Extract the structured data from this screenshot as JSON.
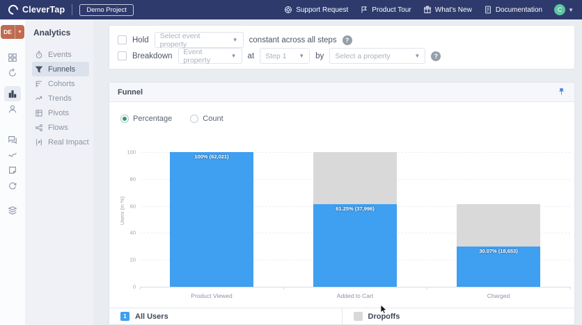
{
  "navbar": {
    "brand": "CleverTap",
    "project_button": "Demo Project",
    "links": [
      {
        "icon": "lifebuoy-icon",
        "label": "Support Request"
      },
      {
        "icon": "product-tour-icon",
        "label": "Product Tour"
      },
      {
        "icon": "gift-icon",
        "label": "What's New"
      },
      {
        "icon": "document-icon",
        "label": "Documentation"
      }
    ],
    "avatar_initial": "C"
  },
  "sidebar": {
    "account_badge": "DE",
    "menu_title": "Analytics",
    "items": [
      {
        "label": "Events",
        "active": false
      },
      {
        "label": "Funnels",
        "active": true
      },
      {
        "label": "Cohorts",
        "active": false
      },
      {
        "label": "Trends",
        "active": false
      },
      {
        "label": "Pivots",
        "active": false
      },
      {
        "label": "Flows",
        "active": false
      },
      {
        "label": "Real Impact",
        "active": false
      }
    ]
  },
  "filters": {
    "hold": {
      "label": "Hold",
      "dropdown_placeholder": "Select event property",
      "suffix": "constant across all steps"
    },
    "breakdown": {
      "label": "Breakdown",
      "dropdown1_placeholder": "Event property",
      "at_label": "at",
      "dropdown2_value": "Step 1",
      "by_label": "by",
      "dropdown3_placeholder": "Select a property"
    }
  },
  "funnel_panel": {
    "title": "Funnel",
    "view_options": [
      {
        "label": "Percentage",
        "selected": true
      },
      {
        "label": "Count",
        "selected": false
      }
    ]
  },
  "chart_data": {
    "type": "bar",
    "stacked": true,
    "title": "Funnel",
    "ylabel": "Users (in %)",
    "ylim": [
      0,
      100
    ],
    "yticks": [
      0,
      20,
      40,
      60,
      80,
      100
    ],
    "categories": [
      "Product Viewed",
      "Added to Cart",
      "Charged"
    ],
    "series": [
      {
        "name": "All Users",
        "color": "#3f9ff0",
        "values": [
          100,
          61.25,
          30.07
        ],
        "value_labels": [
          "100% (62,021)",
          "61.25% (37,996)",
          "30.07% (18,653)"
        ]
      },
      {
        "name": "Dropoffs",
        "color": "#d9d9d9",
        "values": [
          0,
          38.75,
          31.18
        ]
      }
    ],
    "legend_position": "bottom",
    "grid": true
  },
  "legend": [
    {
      "badge": "1",
      "label": "All Users",
      "color": "#3f9ff0"
    },
    {
      "badge": "",
      "label": "Dropoffs",
      "color": "#d9d9d9"
    }
  ],
  "colors": {
    "navbar_bg": "#2e3a6c",
    "account_badge_orange": "#bf6b50",
    "avatar_green": "#5fc3a4",
    "bar_blue": "#3f9ff0",
    "dropoff_gray": "#d9d9d9",
    "radio_green": "#27a265",
    "pin_blue": "#4d7fe0"
  }
}
